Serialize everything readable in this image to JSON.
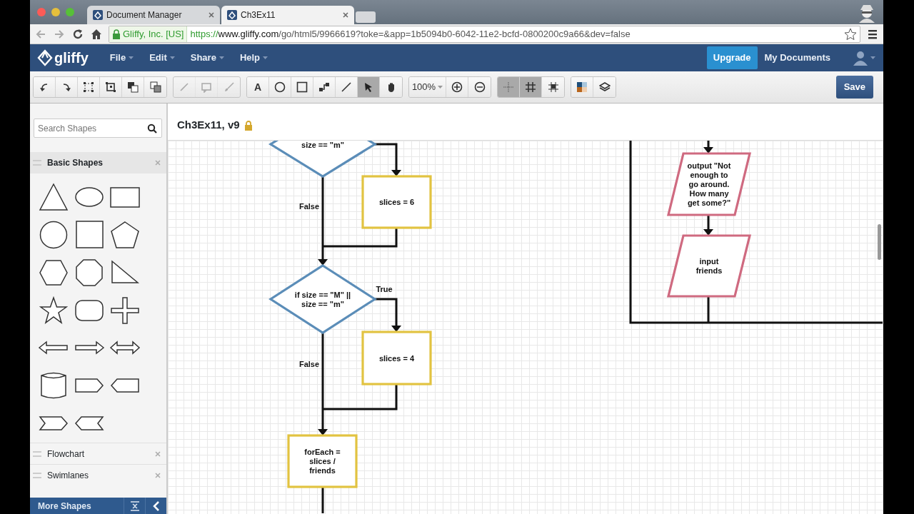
{
  "browser": {
    "tabs": [
      {
        "title": "Document Manager",
        "selected": false
      },
      {
        "title": "Ch3Ex11",
        "selected": true
      }
    ],
    "identity": "Gliffy, Inc. [US]",
    "url_scheme": "https://",
    "url_host": "www.gliffy.com",
    "url_path": "/go/html5/9966619?toke=&app=1b5094b0-6042-11e2-bcfd-0800200c9a66&dev=false"
  },
  "app": {
    "logo": "gliffy",
    "menus": [
      "File",
      "Edit",
      "Share",
      "Help"
    ],
    "upgrade": "Upgrade",
    "my_documents": "My Documents"
  },
  "toolbar": {
    "groups": [
      {
        "items": [
          {
            "kind": "undo",
            "selected": false,
            "disabled": false
          },
          {
            "kind": "redo",
            "selected": false,
            "disabled": false
          },
          {
            "kind": "group",
            "selected": false,
            "disabled": false
          },
          {
            "kind": "ungroup",
            "selected": false,
            "disabled": false
          },
          {
            "kind": "front",
            "selected": false,
            "disabled": false
          },
          {
            "kind": "back",
            "selected": false,
            "disabled": false
          }
        ]
      },
      {
        "items": [
          {
            "kind": "link",
            "selected": false,
            "disabled": true
          },
          {
            "kind": "comment",
            "selected": false,
            "disabled": true
          },
          {
            "kind": "brush",
            "selected": false,
            "disabled": true
          }
        ]
      },
      {
        "items": [
          {
            "kind": "text",
            "label": "A",
            "selected": false,
            "disabled": false
          },
          {
            "kind": "ellipse",
            "selected": false,
            "disabled": false
          },
          {
            "kind": "rectangle",
            "selected": false,
            "disabled": false
          },
          {
            "kind": "connector",
            "selected": false,
            "disabled": false
          },
          {
            "kind": "line",
            "selected": false,
            "disabled": false
          },
          {
            "kind": "pointer",
            "selected": true,
            "disabled": false
          },
          {
            "kind": "hand",
            "selected": false,
            "disabled": false
          }
        ]
      },
      {
        "items": [
          {
            "kind": "zoom",
            "label": "100%",
            "selected": false,
            "disabled": false
          },
          {
            "kind": "zoom-in",
            "selected": false,
            "disabled": false
          },
          {
            "kind": "zoom-out",
            "selected": false,
            "disabled": false
          }
        ]
      },
      {
        "items": [
          {
            "kind": "crosshair",
            "selected": true,
            "disabled": false
          },
          {
            "kind": "grid",
            "selected": true,
            "disabled": false
          },
          {
            "kind": "snap",
            "selected": false,
            "disabled": false
          }
        ]
      },
      {
        "items": [
          {
            "kind": "palette",
            "selected": false,
            "disabled": false
          },
          {
            "kind": "layers",
            "selected": false,
            "disabled": false
          }
        ]
      }
    ],
    "save": "Save"
  },
  "sidebar": {
    "search": {
      "placeholder": "Search Shapes"
    },
    "library": {
      "title": "Basic Shapes",
      "expanded": true,
      "shapes": [
        {
          "kind": "triangle"
        },
        {
          "kind": "ellipse"
        },
        {
          "kind": "rectangle"
        },
        {
          "kind": "circle"
        },
        {
          "kind": "square"
        },
        {
          "kind": "pentagon"
        },
        {
          "kind": "hexagon"
        },
        {
          "kind": "octagon"
        },
        {
          "kind": "right-triangle"
        },
        {
          "kind": "star"
        },
        {
          "kind": "rounded-rect"
        },
        {
          "kind": "cross"
        },
        {
          "kind": "arrow-left"
        },
        {
          "kind": "arrow-right"
        },
        {
          "kind": "arrow-double"
        },
        {
          "kind": "cylinder"
        },
        {
          "kind": "tag-right"
        },
        {
          "kind": "tag-left"
        },
        {
          "kind": "chevron-right"
        },
        {
          "kind": "chevron-left"
        }
      ]
    },
    "other_libraries": [
      {
        "title": "Flowchart"
      },
      {
        "title": "Swimlanes"
      }
    ],
    "footer": "More Shapes"
  },
  "document": {
    "title": "Ch3Ex11, v9",
    "locked": true
  },
  "diagram": {
    "nodes": [
      {
        "kind": "decision",
        "color": "#5b8db8",
        "lines": [
          "size == \"m\""
        ]
      },
      {
        "kind": "process",
        "color": "#e2c341",
        "lines": [
          "slices = 6"
        ]
      },
      {
        "kind": "decision",
        "color": "#5b8db8",
        "lines": [
          "if size == \"M\" ||",
          "size == \"m\""
        ]
      },
      {
        "kind": "process",
        "color": "#e2c341",
        "lines": [
          "slices = 4"
        ]
      },
      {
        "kind": "process",
        "color": "#e2c341",
        "lines": [
          "forEach =",
          "slices /",
          "friends"
        ]
      },
      {
        "kind": "io",
        "color": "#cf6a80",
        "lines": [
          "output \"Not",
          "enough to",
          "go around.",
          "How many",
          "get some?\""
        ]
      },
      {
        "kind": "io",
        "color": "#cf6a80",
        "lines": [
          "input",
          "friends"
        ]
      }
    ],
    "edge_labels": [
      "False",
      "True",
      "False"
    ]
  }
}
